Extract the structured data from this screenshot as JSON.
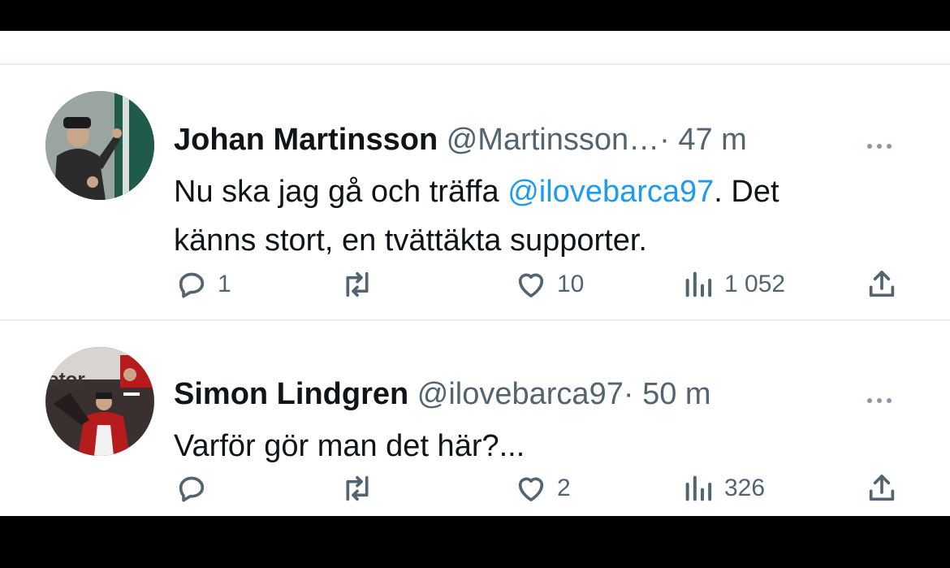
{
  "colors": {
    "text": "#0f1419",
    "secondary": "#536471",
    "link": "#1d9bf0",
    "divider": "#e6ecf0"
  },
  "tweets": [
    {
      "name": "Johan Martinsson",
      "handle": "@Martinsson…",
      "separator": "·",
      "time": "47 m",
      "text_line1_prefix": "Nu ska jag gå och träffa ",
      "mention": "@ilovebarca97",
      "text_line1_suffix": ". Det",
      "text_line2": "känns stort, en tvättäkta supporter.",
      "replies": "1",
      "retweets": "",
      "likes": "10",
      "views": "1 052",
      "icons": [
        "reply-icon",
        "retweet-icon",
        "like-icon",
        "views-icon",
        "share-icon",
        "more-icon"
      ]
    },
    {
      "name": "Simon Lindgren",
      "handle": "@ilovebarca97",
      "separator": "·",
      "time": "50 m",
      "text_line1": "Varför gör man det här?...",
      "replies": "",
      "retweets": "",
      "likes": "2",
      "views": "326",
      "avatar_text": "otor",
      "icons": [
        "reply-icon",
        "retweet-icon",
        "like-icon",
        "views-icon",
        "share-icon",
        "more-icon"
      ]
    }
  ]
}
